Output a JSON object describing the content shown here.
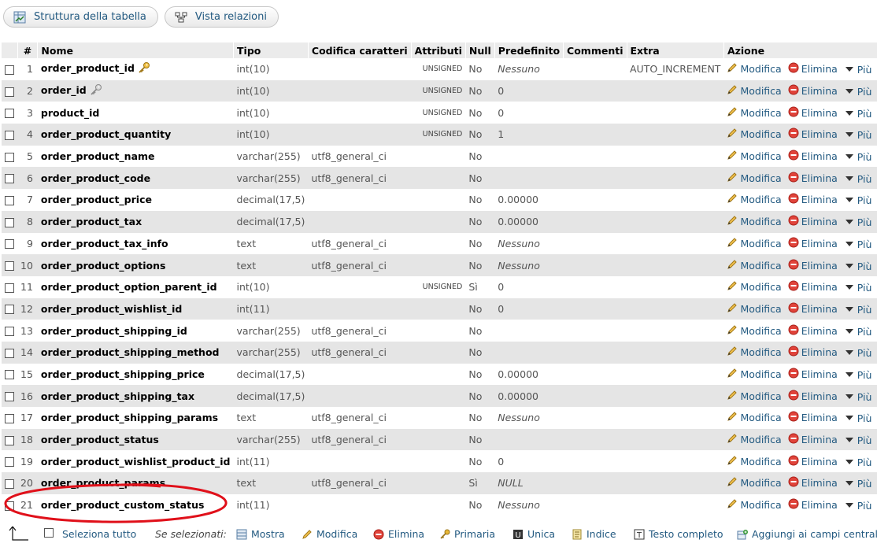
{
  "tabs": [
    {
      "label": "Struttura della tabella",
      "icon": "table-structure-icon"
    },
    {
      "label": "Vista relazioni",
      "icon": "relation-view-icon"
    }
  ],
  "headers": {
    "num": "#",
    "name": "Nome",
    "type": "Tipo",
    "collation": "Codifica caratteri",
    "attributes": "Attributi",
    "null": "Null",
    "default": "Predefinito",
    "comments": "Commenti",
    "extra": "Extra",
    "action": "Azione"
  },
  "actions": {
    "edit": "Modifica",
    "drop": "Elimina",
    "more": "Più"
  },
  "rows": [
    {
      "num": "1",
      "name": "order_product_id",
      "key": "primary",
      "type": "int(10)",
      "collation": "",
      "attributes": "UNSIGNED",
      "null": "No",
      "default": "Nessuno",
      "extra": "AUTO_INCREMENT"
    },
    {
      "num": "2",
      "name": "order_id",
      "key": "index",
      "type": "int(10)",
      "collation": "",
      "attributes": "UNSIGNED",
      "null": "No",
      "default": "0",
      "extra": ""
    },
    {
      "num": "3",
      "name": "product_id",
      "key": "",
      "type": "int(10)",
      "collation": "",
      "attributes": "UNSIGNED",
      "null": "No",
      "default": "0",
      "extra": ""
    },
    {
      "num": "4",
      "name": "order_product_quantity",
      "key": "",
      "type": "int(10)",
      "collation": "",
      "attributes": "UNSIGNED",
      "null": "No",
      "default": "1",
      "extra": ""
    },
    {
      "num": "5",
      "name": "order_product_name",
      "key": "",
      "type": "varchar(255)",
      "collation": "utf8_general_ci",
      "attributes": "",
      "null": "No",
      "default": "",
      "extra": ""
    },
    {
      "num": "6",
      "name": "order_product_code",
      "key": "",
      "type": "varchar(255)",
      "collation": "utf8_general_ci",
      "attributes": "",
      "null": "No",
      "default": "",
      "extra": ""
    },
    {
      "num": "7",
      "name": "order_product_price",
      "key": "",
      "type": "decimal(17,5)",
      "collation": "",
      "attributes": "",
      "null": "No",
      "default": "0.00000",
      "extra": ""
    },
    {
      "num": "8",
      "name": "order_product_tax",
      "key": "",
      "type": "decimal(17,5)",
      "collation": "",
      "attributes": "",
      "null": "No",
      "default": "0.00000",
      "extra": ""
    },
    {
      "num": "9",
      "name": "order_product_tax_info",
      "key": "",
      "type": "text",
      "collation": "utf8_general_ci",
      "attributes": "",
      "null": "No",
      "default": "Nessuno",
      "extra": ""
    },
    {
      "num": "10",
      "name": "order_product_options",
      "key": "",
      "type": "text",
      "collation": "utf8_general_ci",
      "attributes": "",
      "null": "No",
      "default": "Nessuno",
      "extra": ""
    },
    {
      "num": "11",
      "name": "order_product_option_parent_id",
      "key": "",
      "type": "int(10)",
      "collation": "",
      "attributes": "UNSIGNED",
      "null": "Sì",
      "default": "0",
      "extra": ""
    },
    {
      "num": "12",
      "name": "order_product_wishlist_id",
      "key": "",
      "type": "int(11)",
      "collation": "",
      "attributes": "",
      "null": "No",
      "default": "0",
      "extra": ""
    },
    {
      "num": "13",
      "name": "order_product_shipping_id",
      "key": "",
      "type": "varchar(255)",
      "collation": "utf8_general_ci",
      "attributes": "",
      "null": "No",
      "default": "",
      "extra": ""
    },
    {
      "num": "14",
      "name": "order_product_shipping_method",
      "key": "",
      "type": "varchar(255)",
      "collation": "utf8_general_ci",
      "attributes": "",
      "null": "No",
      "default": "",
      "extra": ""
    },
    {
      "num": "15",
      "name": "order_product_shipping_price",
      "key": "",
      "type": "decimal(17,5)",
      "collation": "",
      "attributes": "",
      "null": "No",
      "default": "0.00000",
      "extra": ""
    },
    {
      "num": "16",
      "name": "order_product_shipping_tax",
      "key": "",
      "type": "decimal(17,5)",
      "collation": "",
      "attributes": "",
      "null": "No",
      "default": "0.00000",
      "extra": ""
    },
    {
      "num": "17",
      "name": "order_product_shipping_params",
      "key": "",
      "type": "text",
      "collation": "utf8_general_ci",
      "attributes": "",
      "null": "No",
      "default": "Nessuno",
      "extra": ""
    },
    {
      "num": "18",
      "name": "order_product_status",
      "key": "",
      "type": "varchar(255)",
      "collation": "utf8_general_ci",
      "attributes": "",
      "null": "No",
      "default": "",
      "extra": ""
    },
    {
      "num": "19",
      "name": "order_product_wishlist_product_id",
      "key": "",
      "type": "int(11)",
      "collation": "",
      "attributes": "",
      "null": "No",
      "default": "0",
      "extra": ""
    },
    {
      "num": "20",
      "name": "order_product_params",
      "key": "",
      "type": "text",
      "collation": "utf8_general_ci",
      "attributes": "",
      "null": "Sì",
      "default": "NULL",
      "extra": ""
    },
    {
      "num": "21",
      "name": "order_product_custom_status",
      "key": "",
      "type": "int(11)",
      "collation": "",
      "attributes": "",
      "null": "No",
      "default": "Nessuno",
      "extra": ""
    }
  ],
  "footer": {
    "select_all": "Seleziona tutto",
    "with_selected": "Se selezionati:",
    "actions": [
      {
        "label": "Mostra",
        "icon": "browse-icon"
      },
      {
        "label": "Modifica",
        "icon": "pencil-icon"
      },
      {
        "label": "Elimina",
        "icon": "delete-icon"
      },
      {
        "label": "Primaria",
        "icon": "primary-key-icon"
      },
      {
        "label": "Unica",
        "icon": "unique-icon"
      },
      {
        "label": "Indice",
        "icon": "index-icon"
      },
      {
        "label": "Testo completo",
        "icon": "fulltext-icon"
      },
      {
        "label": "Aggiungi ai campi centrali",
        "icon": "central-columns-icon"
      }
    ]
  },
  "colors": {
    "link": "#235a81",
    "annotation": "#e0101a",
    "row_alt": "#e5e5e5",
    "header_bg": "#ebebeb"
  }
}
